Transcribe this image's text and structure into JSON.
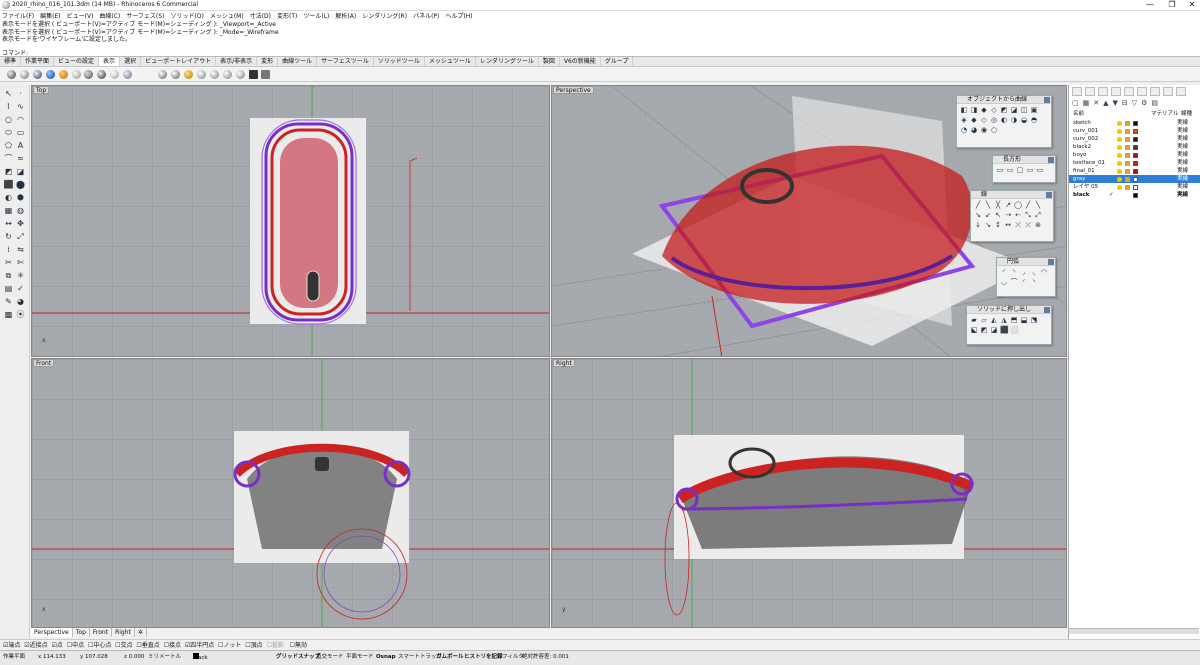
{
  "window": {
    "title": "2020_rhino_016_101.3dm (14 MB) - Rhinoceros 6 Commercial",
    "controls": [
      "—",
      "❐",
      "✕"
    ]
  },
  "menu": [
    "ファイル(F)",
    "編集(E)",
    "ビュー(V)",
    "曲線(C)",
    "サーフェス(S)",
    "ソリッド(O)",
    "メッシュ(M)",
    "寸法(D)",
    "変形(T)",
    "ツール(L)",
    "解析(A)",
    "レンダリング(R)",
    "パネル(P)",
    "ヘルプ(H)"
  ],
  "command_history": [
    "表示モードを選択 ( ビューポート(V)=アクティブ  モード(M)=シェーディング ): _Viewport=_Active",
    "表示モードを選択 ( ビューポート(V)=アクティブ  モード(M)=シェーディング ): _Mode=_Wireframe",
    "表示モードを'ワイヤフレーム'に設定しました。"
  ],
  "command_prompt": "コマンド:",
  "toolbar_tabs": [
    "標準",
    "作業平面",
    "ビューの設定",
    "表示",
    "選択",
    "ビューポートレイアウト",
    "表示/非表示",
    "変形",
    "曲線ツール",
    "サーフェスツール",
    "ソリッドツール",
    "メッシュツール",
    "レンダリングツール",
    "製図",
    "V6の新機能",
    "グループ"
  ],
  "active_tab": "表示",
  "viewports": {
    "top": "Top",
    "perspective": "Perspective",
    "front": "Front",
    "right": "Right"
  },
  "panels": {
    "object_from_curve": "オブジェクトから曲線",
    "rectangle": "長方形",
    "line": "線",
    "arc": "円弧",
    "solid_extrude": "ソリッドに押し出し"
  },
  "layers": {
    "headers": {
      "name": "名前",
      "material": "マテリアル",
      "linetype": "線種"
    },
    "rows": [
      {
        "name": "sketch",
        "linetype": "実線",
        "color": "#000000"
      },
      {
        "name": "curv_001",
        "linetype": "実線",
        "color": "#c06030"
      },
      {
        "name": "curv_002",
        "linetype": "実線",
        "color": "#1a1a1a"
      },
      {
        "name": "black2",
        "linetype": "実線",
        "color": "#3a3a3a"
      },
      {
        "name": "hoyo",
        "linetype": "実線",
        "color": "#8a1c1c"
      },
      {
        "name": "testface_01",
        "linetype": "実線",
        "color": "#c81e1e"
      },
      {
        "name": "final_01",
        "linetype": "実線",
        "color": "#a01010"
      },
      {
        "name": "gray",
        "linetype": "実線",
        "color": "#ffffff",
        "selected": true
      },
      {
        "name": "レイヤ 05",
        "linetype": "実線",
        "color": "#ffffff"
      },
      {
        "name": "black",
        "linetype": "実線",
        "color": "#000000",
        "current": true
      }
    ]
  },
  "viewport_tabs": [
    "Perspective",
    "Top",
    "Front",
    "Right",
    "✲"
  ],
  "osnap": [
    {
      "label": "端点",
      "checked": true
    },
    {
      "label": "近接点",
      "checked": true
    },
    {
      "label": "点",
      "checked": true
    },
    {
      "label": "中点",
      "checked": false
    },
    {
      "label": "中心点",
      "checked": false
    },
    {
      "label": "交点",
      "checked": false
    },
    {
      "label": "垂直点",
      "checked": false
    },
    {
      "label": "接点",
      "checked": false
    },
    {
      "label": "四半円点",
      "checked": true
    },
    {
      "label": "ノット",
      "checked": false
    },
    {
      "label": "頂点",
      "checked": false
    },
    {
      "label": "投影",
      "checked": false
    },
    {
      "label": "無効",
      "checked": false
    }
  ],
  "status": {
    "cplane": "作業平面",
    "x": "x 114.133",
    "y": "y 107.028",
    "z": "z 0.000",
    "units": "ミリメートル",
    "layer": "black",
    "grid_snap": "グリッドスナップ",
    "ortho": "直交モード",
    "planar": "平面モード",
    "osnap": "Osnap",
    "smarttrack": "スマートトラック",
    "gumball": "ガムボール",
    "history": "ヒストリを記録",
    "filter": "フィルタ",
    "tolerance": "絶対許容差: 0.001"
  }
}
